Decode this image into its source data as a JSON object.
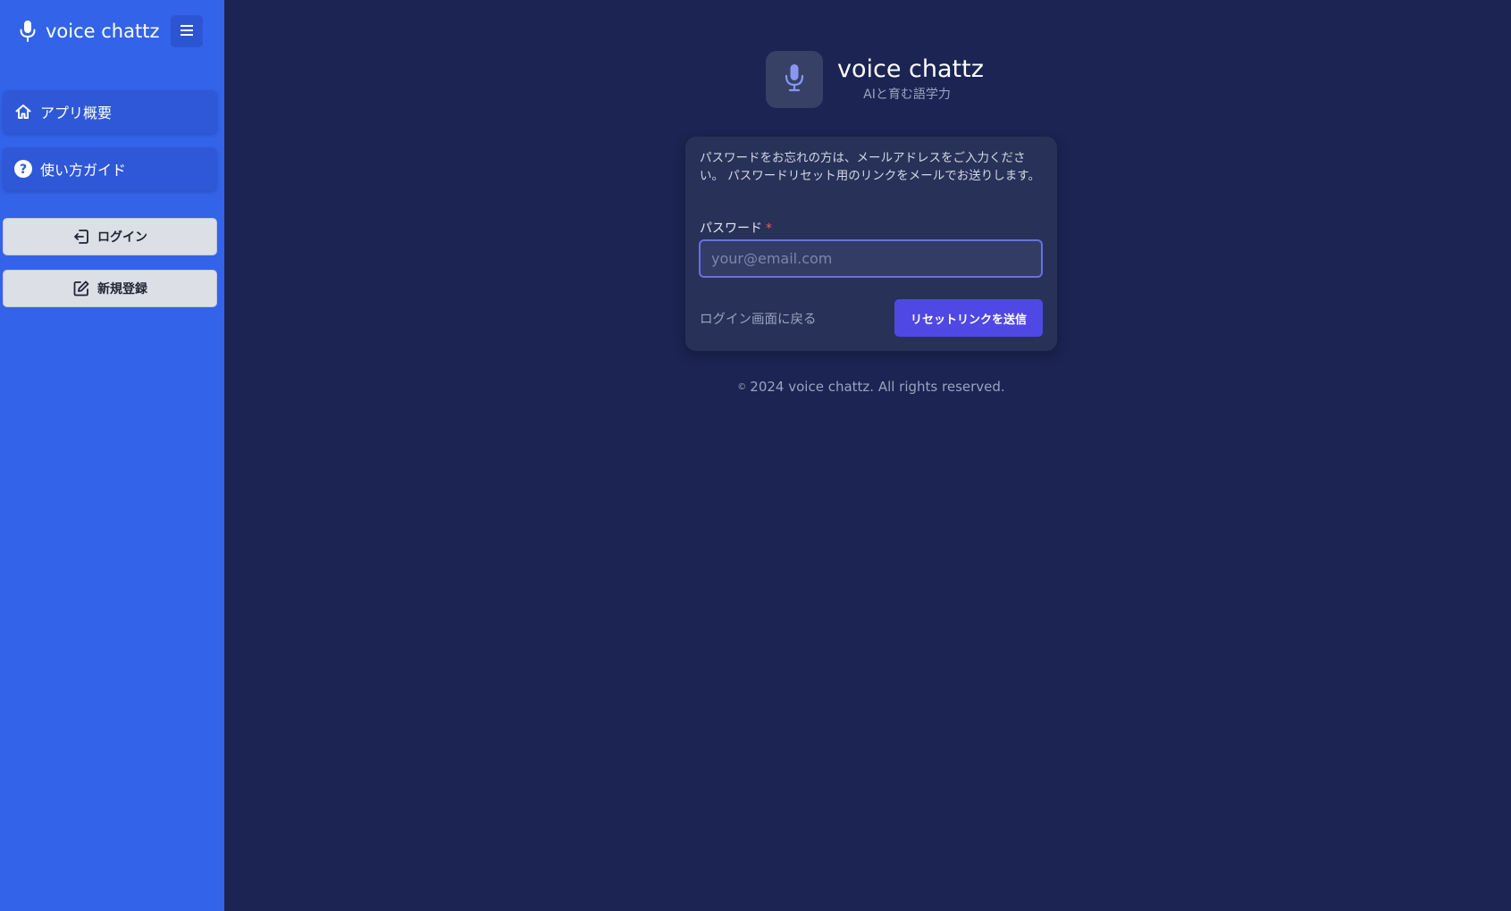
{
  "sidebar": {
    "app_title": "voice chattz",
    "logo_icon": "microphone-icon",
    "menu_icon": "hamburger-menu-icon",
    "nav_items": [
      {
        "label": "アプリ概要",
        "icon": "home-icon"
      },
      {
        "label": "使い方ガイド",
        "icon": "help-circle-icon"
      }
    ],
    "auth_buttons": [
      {
        "label": "ログイン",
        "icon": "login-icon"
      },
      {
        "label": "新規登録",
        "icon": "edit-icon"
      }
    ],
    "colors": {
      "background": "#3363e9",
      "nav_item": "#2f58d9"
    }
  },
  "main": {
    "brand": {
      "title": "voice chattz",
      "subtitle": "AIと育む語学力",
      "icon": "microphone-icon"
    },
    "card": {
      "description": "パスワードをお忘れの方は、メールアドレスをご入力ください。 パスワードリセット用のリンクをメールでお送りします。",
      "field_label": "パスワード",
      "required_mark": "*",
      "email_placeholder": "your@email.com",
      "email_value": "",
      "back_link": "ログイン画面に戻る",
      "submit_label": "リセットリンクを送信"
    },
    "footer": {
      "copyright_symbol": "©",
      "text": "2024 voice chattz. All rights reserved."
    },
    "colors": {
      "background": "#1b2452",
      "card": "#283158",
      "accent": "#5048e5"
    }
  }
}
